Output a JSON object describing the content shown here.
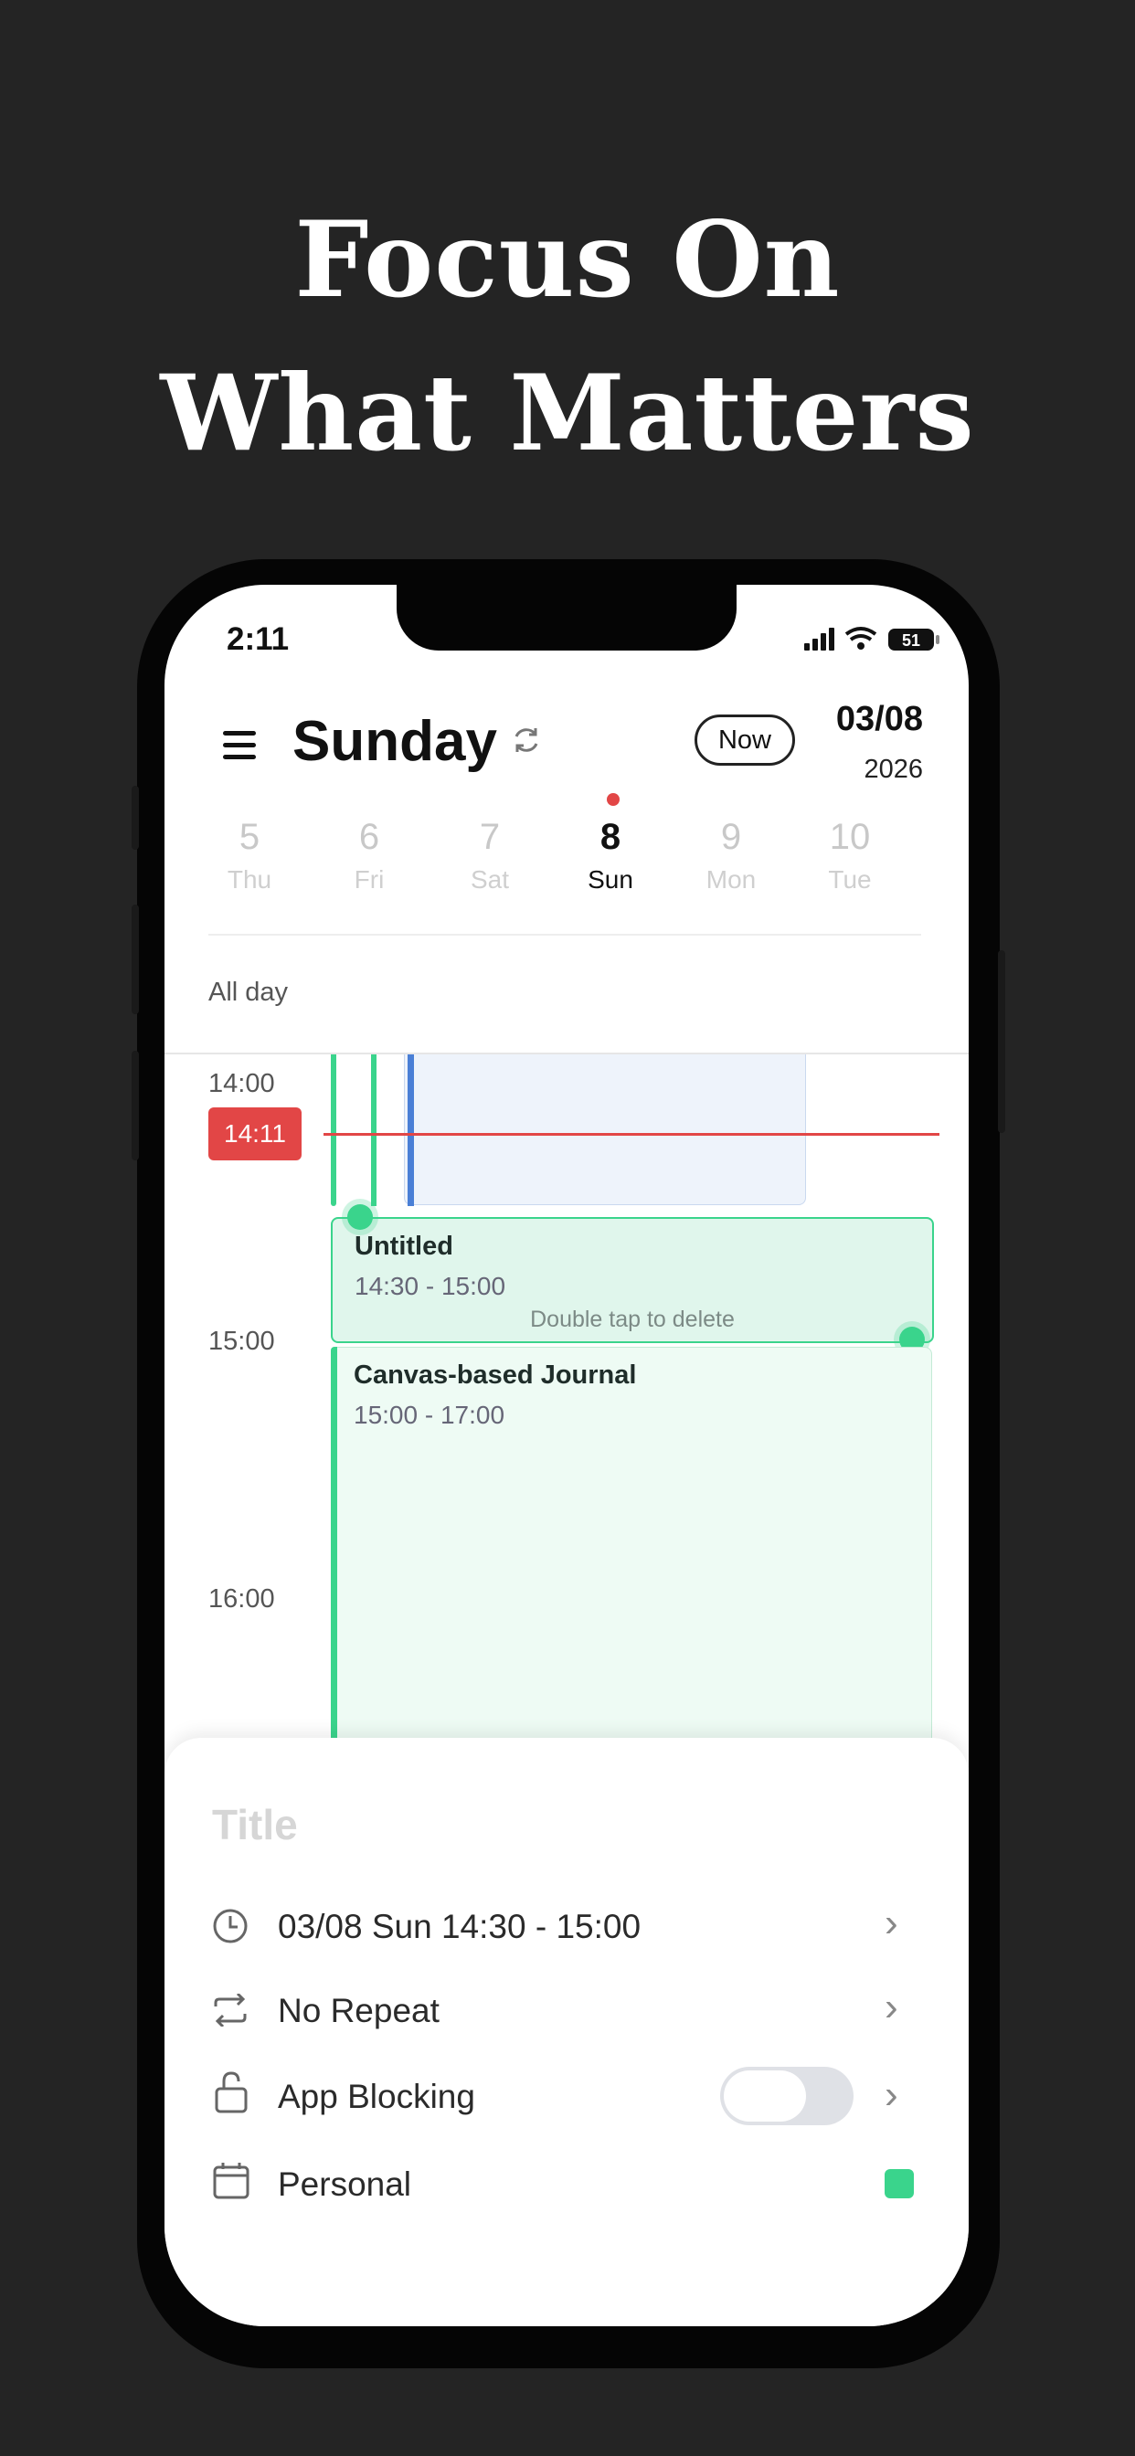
{
  "headline": {
    "line1": "Focus On",
    "line2": "What Matters"
  },
  "status_bar": {
    "time": "2:11",
    "battery": "51"
  },
  "header": {
    "day_title": "Sunday",
    "now_label": "Now",
    "date": "03/08",
    "year": "2026"
  },
  "week": [
    {
      "num": "5",
      "name": "Thu"
    },
    {
      "num": "6",
      "name": "Fri"
    },
    {
      "num": "7",
      "name": "Sat"
    },
    {
      "num": "8",
      "name": "Sun",
      "active": true
    },
    {
      "num": "9",
      "name": "Mon"
    },
    {
      "num": "10",
      "name": "Tue"
    }
  ],
  "all_day_label": "All day",
  "hours": [
    "14:00",
    "15:00",
    "16:00"
  ],
  "now_time": "14:11",
  "events": {
    "untitled": {
      "title": "Untitled",
      "time": "14:30 - 15:00",
      "hint": "Double tap to delete"
    },
    "journal": {
      "title": "Canvas-based Journal",
      "time": "15:00 - 17:00"
    }
  },
  "sheet": {
    "title_placeholder": "Title",
    "datetime": "03/08 Sun 14:30 - 15:00",
    "repeat": "No Repeat",
    "app_blocking": "App Blocking",
    "app_blocking_on": false,
    "calendar": "Personal",
    "calendar_color": "#3ad48c"
  },
  "colors": {
    "accent_green": "#3ad48c",
    "now_red": "#e24646",
    "event_blue": "#4a7fd6"
  }
}
